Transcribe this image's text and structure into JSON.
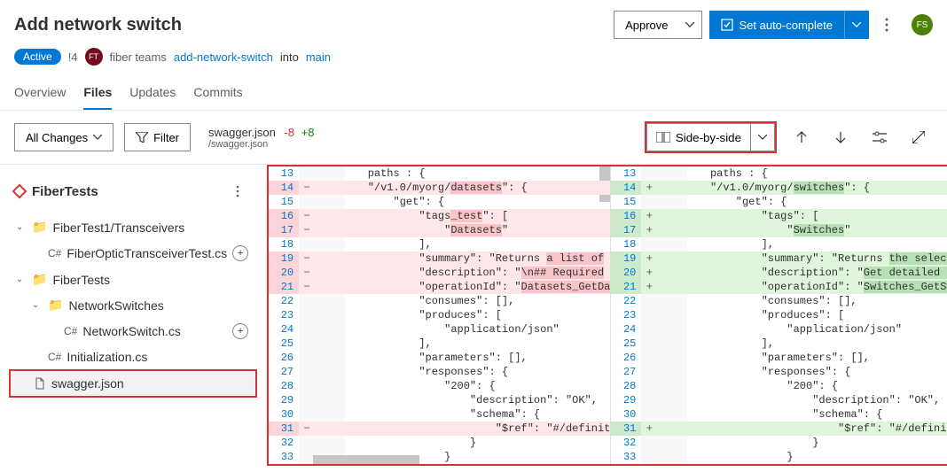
{
  "header": {
    "title": "Add network switch",
    "approve_label": "Approve",
    "autocomplete_label": "Set auto-complete",
    "avatar_initials": "FS"
  },
  "meta": {
    "status": "Active",
    "pr_id": "!4",
    "team_avatar": "FT",
    "team_name": "fiber teams",
    "source_branch": "add-network-switch",
    "into_label": "into",
    "target_branch": "main"
  },
  "tabs": {
    "overview": "Overview",
    "files": "Files",
    "updates": "Updates",
    "commits": "Commits"
  },
  "toolbar": {
    "all_changes": "All Changes",
    "filter": "Filter",
    "file_name": "swagger.json",
    "removed": "-8",
    "added": "+8",
    "file_path": "/swagger.json",
    "view_mode": "Side-by-side"
  },
  "sidebar": {
    "title": "FiberTests",
    "tree": {
      "f1": "FiberTest1/Transceivers",
      "f1_file": "FiberOpticTransceiverTest.cs",
      "f2": "FiberTests",
      "f2_sub": "NetworkSwitches",
      "f2_sub_file": "NetworkSwitch.cs",
      "f2_file2": "Initialization.cs",
      "f2_file3": "swagger.json",
      "cs_prefix": "C#"
    }
  },
  "diff": {
    "left": [
      {
        "n": "13",
        "m": "",
        "c": "        paths : {",
        "cls": ""
      },
      {
        "n": "14",
        "m": "−",
        "c": "        \"/v1.0/myorg/",
        "hl": "datasets",
        "after": "\": {",
        "cls": "removed"
      },
      {
        "n": "15",
        "m": "",
        "c": "            \"get\": {",
        "cls": ""
      },
      {
        "n": "16",
        "m": "−",
        "c": "                \"tags",
        "hl": "_test",
        "after": "\": [",
        "cls": "removed"
      },
      {
        "n": "17",
        "m": "−",
        "c": "                    \"",
        "hl": "Datasets",
        "after": "\"",
        "cls": "removed"
      },
      {
        "n": "18",
        "m": "",
        "c": "                ],",
        "cls": ""
      },
      {
        "n": "19",
        "m": "−",
        "c": "                \"summary\": \"Returns ",
        "hl": "a list of",
        "cls": "removed"
      },
      {
        "n": "20",
        "m": "−",
        "c": "                \"description\": \"",
        "hl": "\\n## Required",
        "cls": "removed"
      },
      {
        "n": "21",
        "m": "−",
        "c": "                \"operationId\": \"",
        "hl": "Datasets_GetDa",
        "cls": "removed"
      },
      {
        "n": "22",
        "m": "",
        "c": "                \"consumes\": [],",
        "cls": ""
      },
      {
        "n": "23",
        "m": "",
        "c": "                \"produces\": [",
        "cls": ""
      },
      {
        "n": "24",
        "m": "",
        "c": "                    \"application/json\"",
        "cls": ""
      },
      {
        "n": "25",
        "m": "",
        "c": "                ],",
        "cls": ""
      },
      {
        "n": "26",
        "m": "",
        "c": "                \"parameters\": [],",
        "cls": ""
      },
      {
        "n": "27",
        "m": "",
        "c": "                \"responses\": {",
        "cls": ""
      },
      {
        "n": "28",
        "m": "",
        "c": "                    \"200\": {",
        "cls": ""
      },
      {
        "n": "29",
        "m": "",
        "c": "                        \"description\": \"OK\",",
        "cls": ""
      },
      {
        "n": "30",
        "m": "",
        "c": "                        \"schema\": {",
        "cls": ""
      },
      {
        "n": "31",
        "m": "−",
        "c": "                            \"$ref\": \"#/definit",
        "cls": "removed"
      },
      {
        "n": "32",
        "m": "",
        "c": "                        }",
        "cls": ""
      },
      {
        "n": "33",
        "m": "",
        "c": "                    }",
        "cls": ""
      }
    ],
    "right": [
      {
        "n": "13",
        "m": "",
        "c": "        paths : {",
        "cls": ""
      },
      {
        "n": "14",
        "m": "+",
        "c": "        \"/v1.0/myorg/",
        "hl": "switches",
        "after": "\": {",
        "cls": "added"
      },
      {
        "n": "15",
        "m": "",
        "c": "            \"get\": {",
        "cls": ""
      },
      {
        "n": "16",
        "m": "+",
        "c": "                \"tags\": [",
        "cls": "added"
      },
      {
        "n": "17",
        "m": "+",
        "c": "                    \"",
        "hl": "Switches",
        "after": "\"",
        "cls": "added"
      },
      {
        "n": "18",
        "m": "",
        "c": "                ],",
        "cls": ""
      },
      {
        "n": "19",
        "m": "+",
        "c": "                \"summary\": \"Returns ",
        "hl": "the select",
        "cls": "added"
      },
      {
        "n": "20",
        "m": "+",
        "c": "                \"description\": \"",
        "hl": "Get detailed s",
        "cls": "added"
      },
      {
        "n": "21",
        "m": "+",
        "c": "                \"operationId\": \"",
        "hl": "Switches_GetSw",
        "cls": "added"
      },
      {
        "n": "22",
        "m": "",
        "c": "                \"consumes\": [],",
        "cls": ""
      },
      {
        "n": "23",
        "m": "",
        "c": "                \"produces\": [",
        "cls": ""
      },
      {
        "n": "24",
        "m": "",
        "c": "                    \"application/json\"",
        "cls": ""
      },
      {
        "n": "25",
        "m": "",
        "c": "                ],",
        "cls": ""
      },
      {
        "n": "26",
        "m": "",
        "c": "                \"parameters\": [],",
        "cls": ""
      },
      {
        "n": "27",
        "m": "",
        "c": "                \"responses\": {",
        "cls": ""
      },
      {
        "n": "28",
        "m": "",
        "c": "                    \"200\": {",
        "cls": ""
      },
      {
        "n": "29",
        "m": "",
        "c": "                        \"description\": \"OK\",",
        "cls": ""
      },
      {
        "n": "30",
        "m": "",
        "c": "                        \"schema\": {",
        "cls": ""
      },
      {
        "n": "31",
        "m": "+",
        "c": "                            \"$ref\": \"#/definit",
        "cls": "added"
      },
      {
        "n": "32",
        "m": "",
        "c": "                        }",
        "cls": ""
      },
      {
        "n": "33",
        "m": "",
        "c": "                    }",
        "cls": ""
      }
    ]
  }
}
